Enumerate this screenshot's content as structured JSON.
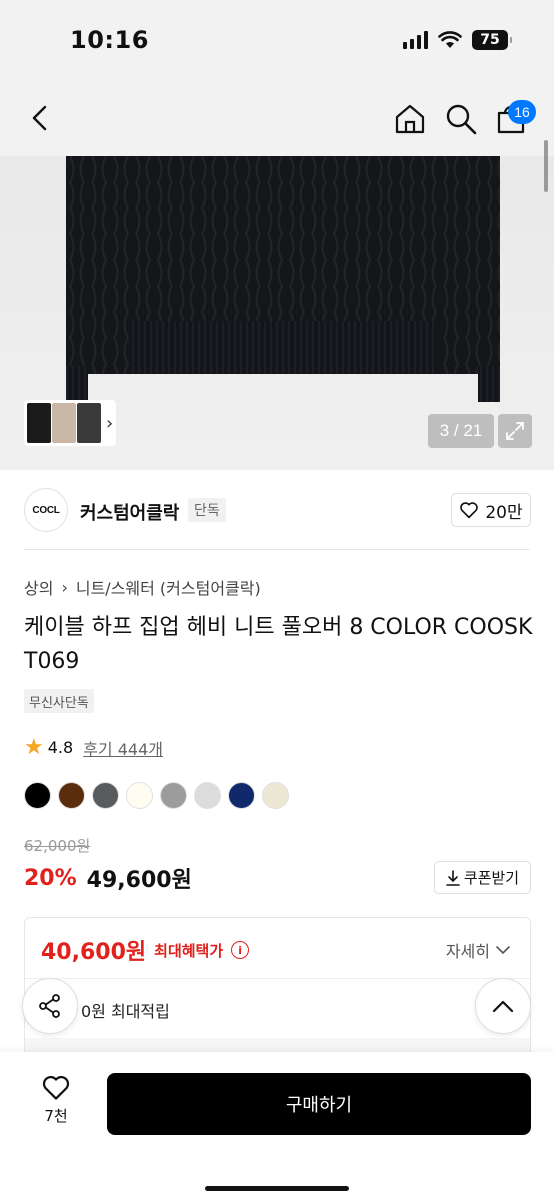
{
  "status_bar": {
    "time": "10:16",
    "battery": "75"
  },
  "nav": {
    "cart_count": "16"
  },
  "gallery": {
    "counter": "3 / 21",
    "thumb_colors": [
      "#1b1b1b",
      "#c9b8a6",
      "#3a3a3a"
    ]
  },
  "brand": {
    "logo_text": "COCL",
    "name": "커스텀어클락",
    "badge": "단독",
    "likes": "20만"
  },
  "breadcrumb": [
    "상의",
    "니트/스웨터 (커스텀어클락)"
  ],
  "product": {
    "title": "케이블 하프 집업 헤비 니트 풀오버 8 COLOR COOSKT069",
    "tag": "무신사단독",
    "rating": "4.8",
    "reviews": "후기 444개",
    "colors": [
      "#000000",
      "#5a2d0c",
      "#595b5e",
      "#fffdf2",
      "#9c9c9c",
      "#dcdcdc",
      "#10296b",
      "#ece8d4"
    ]
  },
  "price": {
    "original": "62,000원",
    "discount": "20%",
    "sale": "49,600원",
    "coupon_label": "쿠폰받기"
  },
  "benefit": {
    "max_price": "40,600원",
    "max_label": "최대혜택가",
    "detail_label": "자세히",
    "points": "0원 최대적립"
  },
  "bottom": {
    "wish_count": "7천",
    "buy_label": "구매하기"
  },
  "colors": {
    "accent_red": "#e2211c",
    "badge_blue": "#0078ff"
  }
}
